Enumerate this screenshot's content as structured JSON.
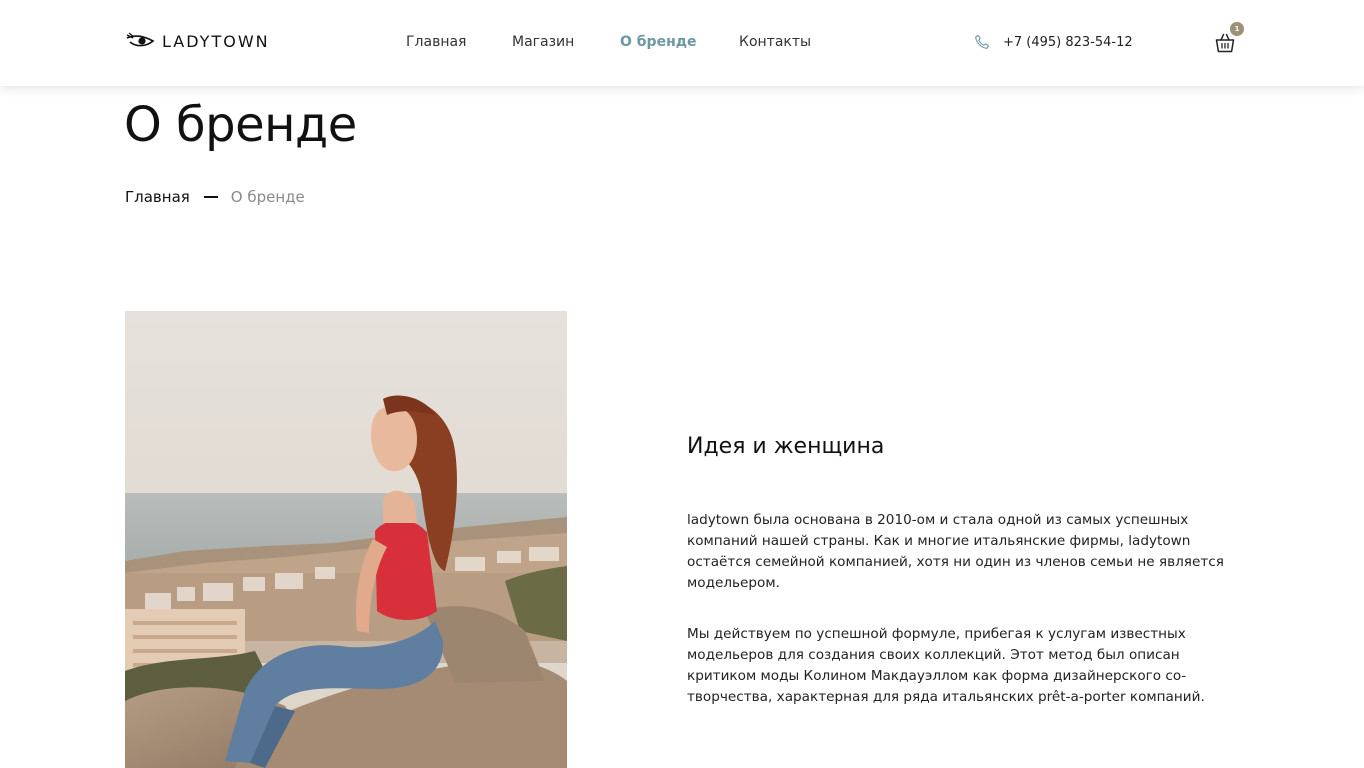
{
  "header": {
    "logo_text": "LADYTOWN",
    "nav": [
      {
        "label": "Главная",
        "active": false
      },
      {
        "label": "Магазин",
        "active": false
      },
      {
        "label": "О бренде",
        "active": true
      },
      {
        "label": "Контакты",
        "active": false
      }
    ],
    "phone": "+7 (495) 823-54-12",
    "cart_count": "1"
  },
  "page": {
    "title": "О бренде",
    "breadcrumb": {
      "home": "Главная",
      "current": "О бренде"
    }
  },
  "content": {
    "section_title": "Идея и женщина",
    "paragraphs": [
      "ladytown была основана в 2010-ом и стала одной из самых успешных компаний нашей страны. Как и многие итальянские фирмы, ladytown остаётся семейной компанией, хотя ни один из членов семьи не является модельером.",
      "Мы действуем по успешной формуле, прибегая к услугам известных модельеров для создания своих коллекций. Этот метод был описан критиком моды Колином Макдауэллом как форма дизайнерского со-творчества, характерная для ряда итальянских prêt-a-porter компаний."
    ]
  },
  "colors": {
    "accent": "#6d97a1",
    "badge": "#9c9276",
    "muted_text": "#8a8a8a"
  },
  "icons": {
    "logo": "eye-icon",
    "phone": "phone-icon",
    "cart": "basket-icon"
  }
}
